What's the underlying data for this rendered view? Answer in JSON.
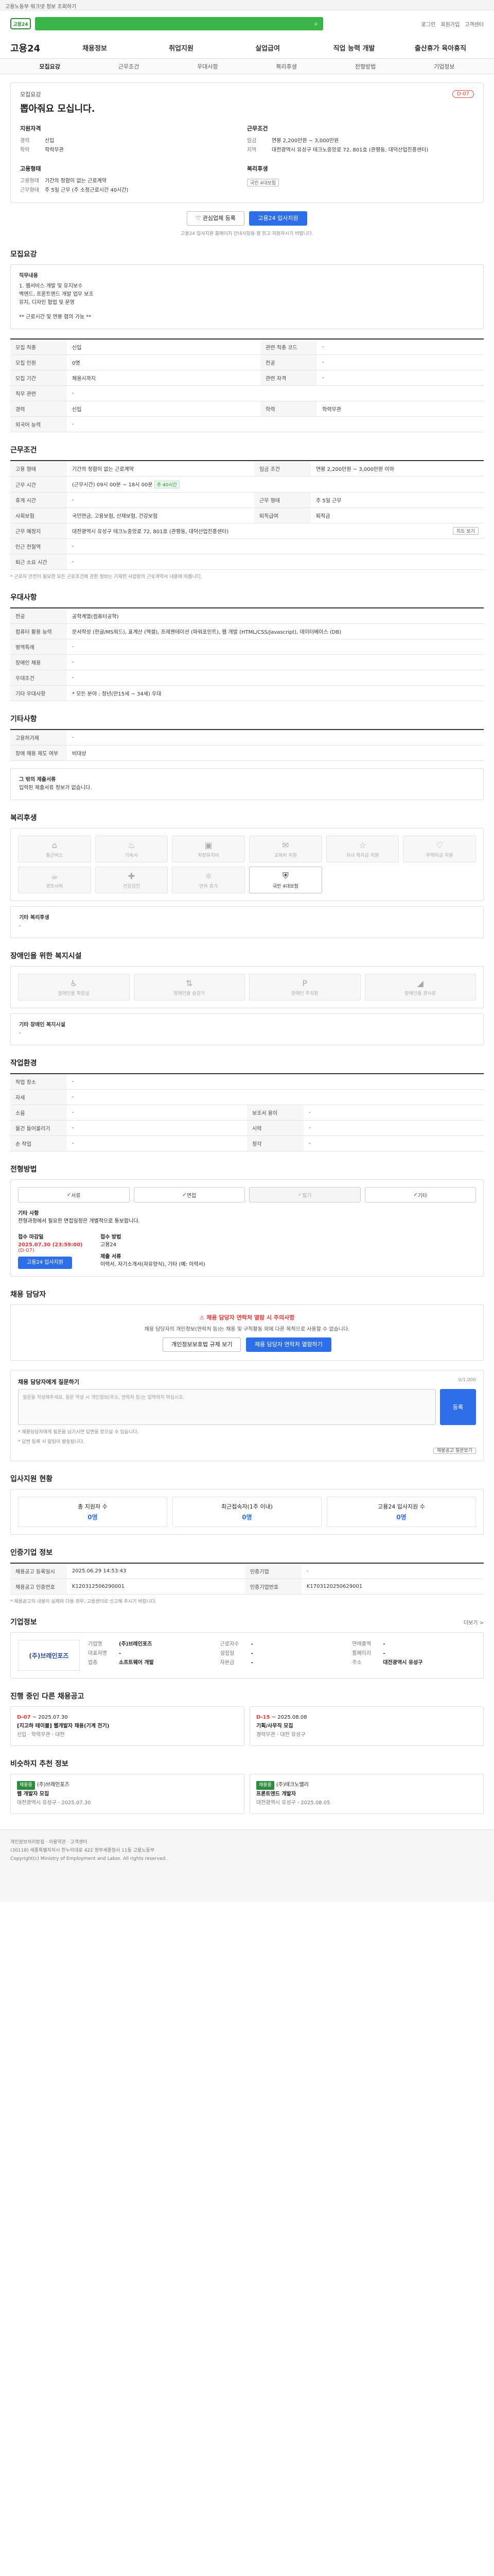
{
  "notice": "고용노동부 워크넷 정보 조회하기",
  "header": {
    "logo": "고용24",
    "search_placeholder": "",
    "right_links": [
      "로그인",
      "회원가입",
      "고객센터"
    ]
  },
  "gnb": {
    "brand": "고용24",
    "items": [
      "채용정보",
      "취업지원",
      "실업급여",
      "직업 능력 개발",
      "출산휴가 육아휴직"
    ]
  },
  "tabs": [
    "모집요강",
    "근무조건",
    "우대사항",
    "복리후생",
    "전형방법",
    "기업정보"
  ],
  "summary": {
    "org": "모집요강",
    "title": "뽑아줘요 모십니다.",
    "hot": "D-07",
    "col1_title": "지원자격",
    "col1": [
      {
        "k": "경력",
        "v": "신입"
      },
      {
        "k": "학력",
        "v": "학력무관"
      }
    ],
    "col2_title": "근무조건",
    "col2": [
      {
        "k": "임금",
        "v": "연봉 2,200만원 ~ 3,000만원"
      },
      {
        "k": "지역",
        "v": "대전광역시 유성구 테크노중앙로 72, 801호 (관평동, 대덕산업진흥센터)"
      }
    ],
    "col3_title": "고용형태",
    "col3": [
      {
        "k": "고용형태",
        "v": "기간의 정함이 없는 근로계약"
      },
      {
        "k": "근무형태",
        "v": "주 5일 근무 (주 소정근로시간 40시간)"
      }
    ],
    "col4_title": "복리후생",
    "col4_chip": "국민 4대보험"
  },
  "actions": {
    "scrap": "관심업체 등록",
    "apply": "고용24 입사지원",
    "note": "고용24 입사지원 홈페이지 안내사항을 잘 읽고 지원하시기 바랍니다."
  },
  "job_desc": {
    "title": "모집요강",
    "heading": "직무내용",
    "lines": [
      "1. 웹서비스 개발 및 유지보수",
      "백엔드, 프론트엔드 개발 업무 보조",
      "유지, 디자인 협업 및 운영",
      "",
      "** 근로시간 및 연봉 협의 가능 **"
    ]
  },
  "recruit_table": [
    {
      "k1": "모집 직종",
      "v1": "신입",
      "k2": "관련 직종 코드",
      "v2": "-"
    },
    {
      "k1": "모집 인원",
      "v1": "0명",
      "k2": "전공",
      "v2": "-"
    },
    {
      "k1": "모집 기간",
      "v1": "채용시까지",
      "k2": "관련 자격",
      "v2": "-"
    },
    {
      "k1": "직무 관련",
      "v1": "-",
      "k2": "",
      "v2": ""
    },
    {
      "k1": "경력",
      "v1": "신입",
      "k2": "학력",
      "v2": "학력무관"
    },
    {
      "k1": "외국어 능력",
      "v1": "-",
      "k2": "",
      "v2": ""
    }
  ],
  "work_table": {
    "title": "근무조건",
    "rows": [
      {
        "k1": "고용 형태",
        "v1": "기간의 정함이 없는 근로계약",
        "k2": "임금 조건",
        "v2": "연봉 2,200만원 ~ 3,000만원 이하"
      },
      {
        "k1": "근무 시간",
        "v1": "(근무시간) 09시 00분 ~ 18시 00분",
        "k2": "",
        "v2": ""
      },
      {
        "k1": "휴게 시간",
        "v1": "-",
        "k2": "근무 형태",
        "v2": "주 5일 근무"
      },
      {
        "k1": "사회보험",
        "v1": "국민연금, 고용보험, 산재보험, 건강보험",
        "k2": "퇴직급여",
        "v2": "퇴직금"
      },
      {
        "k1": "근무 예정지",
        "v1": "대전광역시 유성구 테크노중앙로 72, 801호 (관평동, 대덕산업진흥센터)",
        "k2": "",
        "v2": ""
      },
      {
        "k1": "인근 전철역",
        "v1": "-",
        "k2": "",
        "v2": ""
      },
      {
        "k1": "퇴근 소요 시간",
        "v1": "-",
        "k2": "",
        "v2": ""
      }
    ],
    "map_btn": "지도 보기",
    "work_hours_chip": "주 40시간",
    "note": "* 근로자 안전이 필요한 모든 근로조건에 관한 정보는 기재한 사업장의 근로계약서 내용에 따릅니다."
  },
  "pref_table": {
    "title": "우대사항",
    "rows": [
      {
        "k": "전공",
        "v": "공학계열(컴퓨터공학)"
      },
      {
        "k": "컴퓨터 활용 능력",
        "v": "문서작성 (한글/MS워드), 표계산 (엑셀), 프레젠테이션 (파워포인트), 웹 개발 (HTML/CSS/Javascript), 데이터베이스 (DB)"
      },
      {
        "k": "병역특례",
        "v": "-"
      },
      {
        "k": "장애인 채용",
        "v": "-"
      },
      {
        "k": "우대조건",
        "v": "-"
      },
      {
        "k": "기타 우대사항",
        "v": "* 모든 분야 : 청년(만15세 ~ 34세) 우대"
      }
    ]
  },
  "other_info": {
    "title": "기타사항",
    "rows": [
      {
        "k": "고용허가제",
        "v": "-"
      },
      {
        "k": "장애 채용 제도 여부",
        "v": "비대상"
      }
    ]
  },
  "extra_box": {
    "title": "그 밖의 제출서류",
    "text": "입력된 제출서류 정보가 없습니다."
  },
  "welfare": {
    "title": "복리후생",
    "items": [
      {
        "icon": "home-icon",
        "label": "통근버스",
        "on": false
      },
      {
        "icon": "food-icon",
        "label": "기숙사",
        "on": false
      },
      {
        "icon": "bus-icon",
        "label": "차량유지비",
        "on": false
      },
      {
        "icon": "gift-icon",
        "label": "교육비 지원",
        "on": false
      },
      {
        "icon": "star-icon",
        "label": "자녀 학자금 지원",
        "on": false
      },
      {
        "icon": "heart-icon",
        "label": "주택자금 지원",
        "on": false
      },
      {
        "icon": "cup-icon",
        "label": "경조사비",
        "on": false
      },
      {
        "icon": "gift-icon",
        "label": "건강검진",
        "on": false
      },
      {
        "icon": "cake-icon",
        "label": "연차 휴가",
        "on": false
      },
      {
        "icon": "shield-icon",
        "label": "국민 4대보험",
        "on": true
      }
    ],
    "extra_title": "기타 복리후생",
    "extra_value": "-"
  },
  "disabled_facilities": {
    "title": "장애인을 위한 복지시설",
    "items": [
      "장애인용 화장실",
      "장애인용 승강기",
      "장애인 주차장",
      "장애인용 경사로"
    ],
    "extra_title": "기타 장애인 복지시설",
    "extra_value": "-"
  },
  "work_env": {
    "title": "작업환경",
    "rows": [
      {
        "k1": "작업 장소",
        "v1": "-",
        "k2": "",
        "v2": ""
      },
      {
        "k1": "자세",
        "v1": "-",
        "k2": "",
        "v2": ""
      },
      {
        "k1": "소음",
        "v1": "-",
        "k2": "보조서 용이",
        "v2": "-"
      },
      {
        "k1": "물건 들어올리기",
        "v1": "-",
        "k2": "시력",
        "v2": "-"
      },
      {
        "k1": "손 작업",
        "v1": "-",
        "k2": "청각",
        "v2": "-"
      }
    ]
  },
  "selection": {
    "title": "전형방법",
    "methods": [
      {
        "label": "서류",
        "off": false
      },
      {
        "label": "면접",
        "off": false
      },
      {
        "label": "필기",
        "off": true
      },
      {
        "label": "기타",
        "off": false
      }
    ],
    "etc_title": "기타 사항",
    "etc_text": "전형과정에서 필요한 면접일정은 개별적으로 통보합니다.",
    "apply_title": "접수 마감일",
    "apply_date": "2025.07.30 (23:59:00)",
    "apply_sub": "(D-07)",
    "apply_btn": "고용24 입사지원",
    "method_title": "접수 방법",
    "method_value": "고용24",
    "docs_title": "제출 서류",
    "docs_value": "이력서, 자기소개서(자유양식), 기타 (예: 이력서)"
  },
  "contact": {
    "title": "채용 담당자",
    "warn": "채용 담당자 연락처 열람 시 주의사항",
    "text": "채용 담당자의 개인정보(연락처 등)는 채용 및 구직활동 외에 다른 목적으로 사용할 수 없습니다.",
    "btn1": "개인정보보호법 규제 보기",
    "btn2": "채용 담당자 연락처 열람하기"
  },
  "qna": {
    "title": "채용 담당자에게 질문하기",
    "placeholder": "질문을 작성해주세요. 질문 작성 시 개인정보(주소, 연락처 등)는 입력하지 마십시오.",
    "counter": "0/1,000",
    "btn": "등록",
    "notes": [
      "* 채용담당자에게 질문을 남기시면 답변을 받으실 수 있습니다.",
      "* 답변 등록 시 알림이 발송됩니다."
    ],
    "more": "채용공고 질문보기"
  },
  "apply_status": {
    "title": "입사지원 현황",
    "stats": [
      {
        "label": "총 지원자 수",
        "value": "0명"
      },
      {
        "label": "최근접속자(1주 이내)",
        "value": "0명"
      },
      {
        "label": "고용24 입사지원 수",
        "value": "0명"
      }
    ]
  },
  "info": {
    "title": "인증기업 정보",
    "rows": [
      {
        "k1": "채용공고 등록일시",
        "v1": "2025.06.29 14:53:43",
        "k2": "인증기업",
        "v2": "-"
      },
      {
        "k1": "채용공고 인증번호",
        "v1": "K120312506290001",
        "k2": "인증기업번호",
        "v2": "K1703120250629001"
      }
    ],
    "note": "* 채용공고의 내용이 실제와 다를 경우, 고용센터로 신고해 주시기 바랍니다."
  },
  "company": {
    "title": "기업정보",
    "more": "더보기 >",
    "logo": "(주)브레인포즈",
    "c1": [
      {
        "k": "기업명",
        "v": "(주)브레인포즈"
      },
      {
        "k": "대표자명",
        "v": "-"
      },
      {
        "k": "업종",
        "v": "소프트웨어 개발"
      }
    ],
    "c2": [
      {
        "k": "근로자수",
        "v": "-"
      },
      {
        "k": "설립일",
        "v": "-"
      },
      {
        "k": "자본금",
        "v": "-"
      }
    ],
    "c3": [
      {
        "k": "연매출액",
        "v": "-"
      },
      {
        "k": "홈페이지",
        "v": "-"
      },
      {
        "k": "주소",
        "v": "대전광역시 유성구"
      }
    ]
  },
  "others": {
    "title": "진행 중인 다른 채용공고",
    "cards": [
      {
        "dday": "D-07",
        "date": "~ 2025.07.30",
        "title": "[지고하 테이블] 웹개발자 채용(기계 전기)",
        "meta": "신입 · 학력무관 · 대전"
      },
      {
        "dday": "D-15",
        "date": "~ 2025.08.08",
        "title": "기획/사무직 모집",
        "meta": "경력무관 · 대전 유성구"
      }
    ]
  },
  "similar": {
    "title": "비슷하지 추천 정보",
    "cards": [
      {
        "tag": "채용중",
        "company": "(주)브레인포즈",
        "title": "웹 개발자 모집",
        "meta": "대전광역시 유성구 · 2025.07.30"
      },
      {
        "tag": "채용중",
        "company": "(주)테크노밸리",
        "title": "프론트엔드 개발자",
        "meta": "대전광역시 유성구 · 2025.08.05"
      }
    ]
  },
  "footer": {
    "lines": [
      "개인정보처리방침 · 이용약관 · 고객센터",
      "(30118) 세종특별자치시 한누리대로 422 정부세종청사 11동 고용노동부",
      "Copyright(c) Ministry of Employment and Labor. All rights reserved."
    ]
  }
}
